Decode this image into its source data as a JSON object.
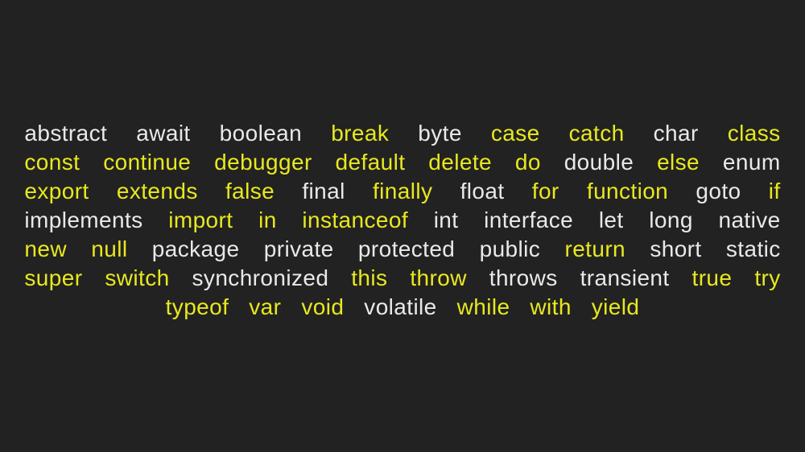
{
  "page": {
    "background_color": "#222222",
    "white_color": "#e9e9e9",
    "yellow_color": "#e8e820",
    "layout": "justified-keyword-block",
    "line_count": 7
  },
  "keywords": [
    {
      "text": "abstract",
      "color": "white"
    },
    {
      "text": "await",
      "color": "white"
    },
    {
      "text": "boolean",
      "color": "white"
    },
    {
      "text": "break",
      "color": "yellow"
    },
    {
      "text": "byte",
      "color": "white"
    },
    {
      "text": "case",
      "color": "yellow"
    },
    {
      "text": "catch",
      "color": "yellow"
    },
    {
      "text": "char",
      "color": "white"
    },
    {
      "text": "class",
      "color": "yellow"
    },
    {
      "text": "const",
      "color": "yellow"
    },
    {
      "text": "continue",
      "color": "yellow"
    },
    {
      "text": "debugger",
      "color": "yellow"
    },
    {
      "text": "default",
      "color": "yellow"
    },
    {
      "text": "delete",
      "color": "yellow"
    },
    {
      "text": "do",
      "color": "yellow"
    },
    {
      "text": "double",
      "color": "white"
    },
    {
      "text": "else",
      "color": "yellow"
    },
    {
      "text": "enum",
      "color": "white"
    },
    {
      "text": "export",
      "color": "yellow"
    },
    {
      "text": "extends",
      "color": "yellow"
    },
    {
      "text": "false",
      "color": "yellow"
    },
    {
      "text": "final",
      "color": "white"
    },
    {
      "text": "finally",
      "color": "yellow"
    },
    {
      "text": "float",
      "color": "white"
    },
    {
      "text": "for",
      "color": "yellow"
    },
    {
      "text": "function",
      "color": "yellow"
    },
    {
      "text": "goto",
      "color": "white"
    },
    {
      "text": "if",
      "color": "yellow"
    },
    {
      "text": "implements",
      "color": "white"
    },
    {
      "text": "import",
      "color": "yellow"
    },
    {
      "text": "in",
      "color": "yellow"
    },
    {
      "text": "instanceof",
      "color": "yellow"
    },
    {
      "text": "int",
      "color": "white"
    },
    {
      "text": "interface",
      "color": "white"
    },
    {
      "text": "let",
      "color": "white"
    },
    {
      "text": "long",
      "color": "white"
    },
    {
      "text": "native",
      "color": "white"
    },
    {
      "text": "new",
      "color": "yellow"
    },
    {
      "text": "null",
      "color": "yellow"
    },
    {
      "text": "package",
      "color": "white"
    },
    {
      "text": "private",
      "color": "white"
    },
    {
      "text": "protected",
      "color": "white"
    },
    {
      "text": "public",
      "color": "white"
    },
    {
      "text": "return",
      "color": "yellow"
    },
    {
      "text": "short",
      "color": "white"
    },
    {
      "text": "static",
      "color": "white"
    },
    {
      "text": "super",
      "color": "yellow"
    },
    {
      "text": "switch",
      "color": "yellow"
    },
    {
      "text": "synchronized",
      "color": "white"
    },
    {
      "text": "this",
      "color": "yellow"
    },
    {
      "text": "throw",
      "color": "yellow"
    },
    {
      "text": "throws",
      "color": "white"
    },
    {
      "text": "transient",
      "color": "white"
    },
    {
      "text": "true",
      "color": "yellow"
    },
    {
      "text": "try",
      "color": "yellow"
    },
    {
      "text": "typeof",
      "color": "yellow"
    },
    {
      "text": "var",
      "color": "yellow"
    },
    {
      "text": "void",
      "color": "yellow"
    },
    {
      "text": "volatile",
      "color": "white"
    },
    {
      "text": "while",
      "color": "yellow"
    },
    {
      "text": "with",
      "color": "yellow"
    },
    {
      "text": "yield",
      "color": "yellow"
    }
  ],
  "lines": [
    {
      "index": 0,
      "words": [
        "abstract",
        "await",
        "boolean",
        "break",
        "byte",
        "case",
        "catch",
        "char",
        "class",
        "const"
      ]
    },
    {
      "index": 1,
      "words": [
        "continue",
        "debugger",
        "default",
        "delete",
        "do",
        "double",
        "else",
        "enum",
        "export"
      ]
    },
    {
      "index": 2,
      "words": [
        "extends",
        "false",
        "final",
        "finally",
        "float",
        "for",
        "function",
        "goto",
        "if",
        "implements"
      ]
    },
    {
      "index": 3,
      "words": [
        "import",
        "in",
        "instanceof",
        "int",
        "interface",
        "let",
        "long",
        "native",
        "new",
        "null"
      ]
    },
    {
      "index": 4,
      "words": [
        "package",
        "private",
        "protected",
        "public",
        "return",
        "short",
        "static",
        "super",
        "switch"
      ]
    },
    {
      "index": 5,
      "words": [
        "synchronized",
        "this",
        "throw",
        "throws",
        "transient",
        "true",
        "try",
        "typeof",
        "var",
        "void"
      ]
    },
    {
      "index": 6,
      "words": [
        "volatile",
        "while",
        "with",
        "yield"
      ]
    }
  ]
}
